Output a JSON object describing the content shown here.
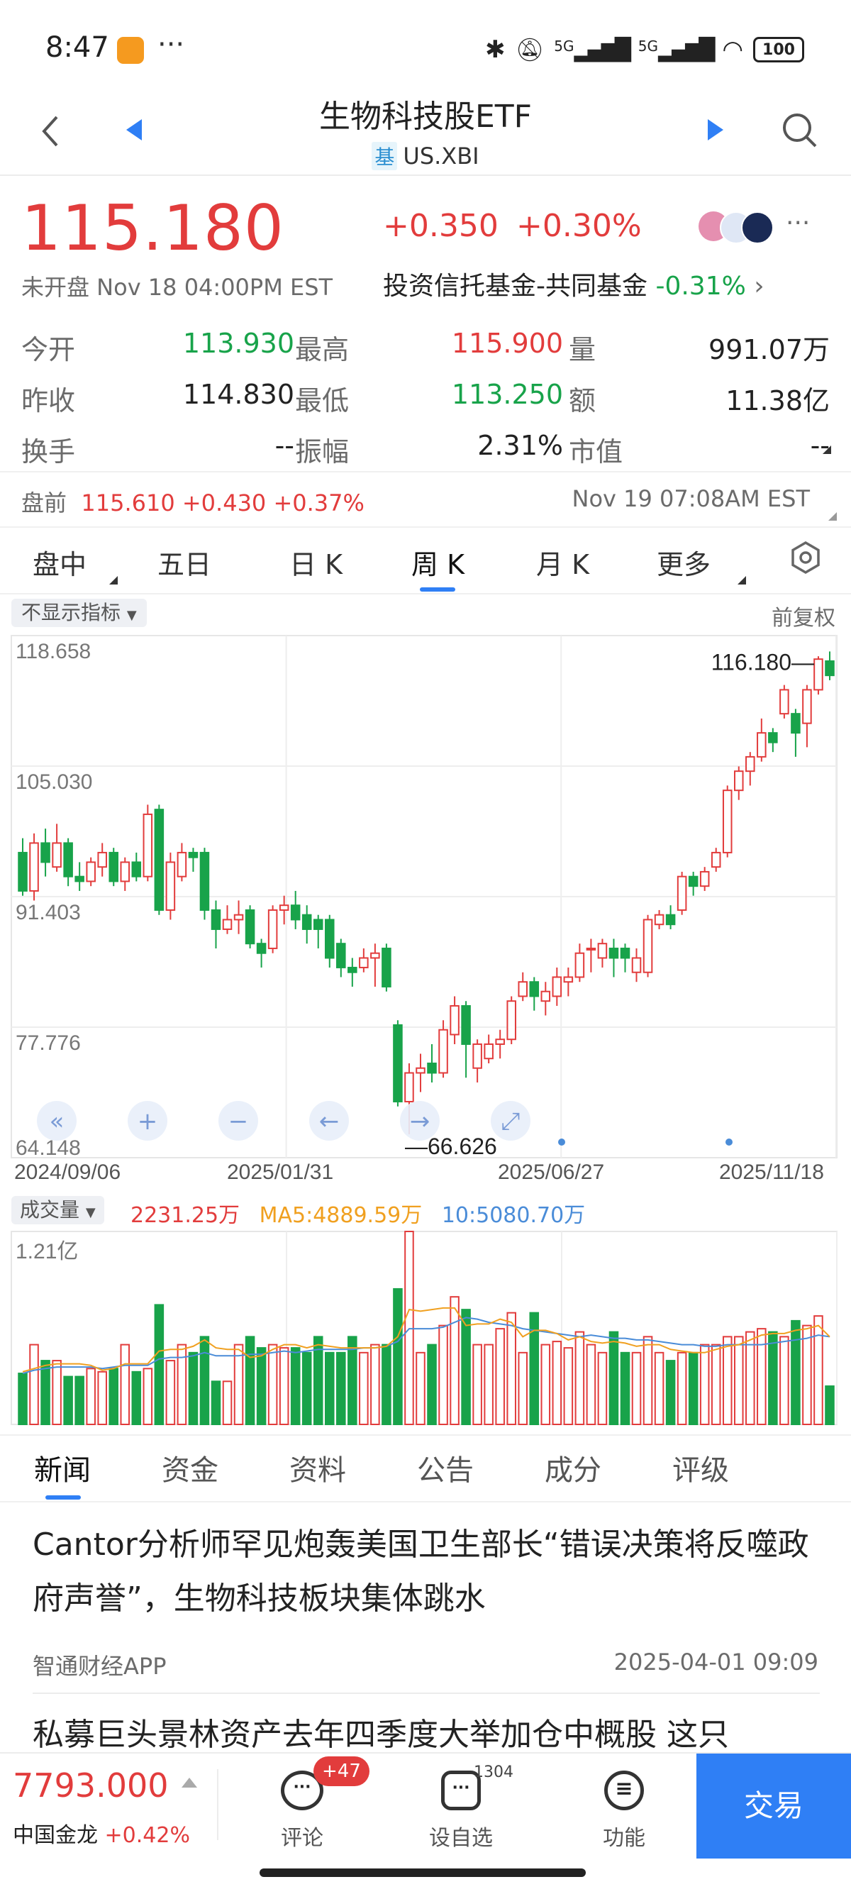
{
  "status": {
    "time": "8:47",
    "dots": "···",
    "signal1": "5G",
    "signal2": "5G",
    "battery": "100"
  },
  "header": {
    "title": "生物科技股ETF",
    "tag": "基",
    "code": "US.XBI"
  },
  "quote": {
    "price": "115.180",
    "change": "+0.350",
    "change_pct": "+0.30%",
    "status_text": "未开盘 Nov 18 04:00PM EST",
    "sector": "投资信托基金-共同基金",
    "sector_change": "-0.31%"
  },
  "stats": {
    "open_label": "今开",
    "open": "113.930",
    "high_label": "最高",
    "high": "115.900",
    "volume_label": "量",
    "volume": "991.07万",
    "prev_label": "昨收",
    "prev": "114.830",
    "low_label": "最低",
    "low": "113.250",
    "amount_label": "额",
    "amount": "11.38亿",
    "turnover_label": "换手",
    "turnover": "--",
    "amplitude_label": "振幅",
    "amplitude": "2.31%",
    "mcap_label": "市值",
    "mcap": "--"
  },
  "premarket": {
    "label": "盘前",
    "price": "115.610",
    "change": "+0.430",
    "pct": "+0.37%",
    "time": "Nov 19 07:08AM EST"
  },
  "chart_tabs": [
    "盘中",
    "五日",
    "日 K",
    "周 K",
    "月 K",
    "更多"
  ],
  "chart_header": {
    "indicator": "不显示指标",
    "adjust": "前复权"
  },
  "volume_header": {
    "label": "成交量",
    "vol": "2231.25万",
    "ma5": "MA5:4889.59万",
    "ma10": "10:5080.70万",
    "max": "1.21亿"
  },
  "colors": {
    "up": "#e23c3c",
    "down": "#18a34a",
    "accent": "#2f7ff5",
    "ma5": "#f0a020",
    "ma10": "#4a8cd8"
  },
  "chart_data": {
    "type": "candlestick",
    "y_ticks": [
      "118.658",
      "105.030",
      "91.403",
      "77.776",
      "64.148"
    ],
    "ylim": [
      64.148,
      118.658
    ],
    "x_labels": [
      "2024/09/06",
      "2025/01/31",
      "2025/06/27",
      "2025/11/18"
    ],
    "annotations": {
      "max_label": "116.180",
      "min_label": "66.626"
    },
    "candles": [
      [
        96.0,
        92.0,
        97.5,
        91.5
      ],
      [
        92.0,
        97.0,
        98.0,
        91.0
      ],
      [
        97.0,
        95.0,
        98.5,
        93.5
      ],
      [
        94.5,
        97.0,
        99.0,
        94.0
      ],
      [
        97.0,
        93.5,
        97.5,
        92.5
      ],
      [
        93.5,
        93.0,
        95.0,
        92.0
      ],
      [
        93.0,
        95.0,
        95.5,
        92.5
      ],
      [
        94.5,
        96.0,
        97.0,
        93.5
      ],
      [
        96.0,
        93.0,
        96.5,
        92.5
      ],
      [
        93.0,
        95.0,
        95.5,
        92.0
      ],
      [
        95.0,
        93.5,
        96.0,
        93.0
      ],
      [
        93.5,
        100.0,
        101.0,
        93.0
      ],
      [
        100.5,
        90.0,
        101.0,
        89.5
      ],
      [
        90.0,
        95.0,
        96.0,
        89.0
      ],
      [
        93.5,
        96.0,
        97.0,
        93.0
      ],
      [
        96.0,
        95.5,
        96.5,
        94.0
      ],
      [
        96.0,
        90.0,
        96.5,
        89.0
      ],
      [
        90.0,
        88.0,
        91.0,
        86.0
      ],
      [
        88.0,
        89.0,
        90.5,
        87.5
      ],
      [
        89.0,
        89.5,
        91.0,
        87.5
      ],
      [
        90.0,
        86.5,
        90.5,
        86.0
      ],
      [
        86.5,
        85.5,
        87.0,
        84.0
      ],
      [
        86.0,
        90.0,
        90.5,
        85.5
      ],
      [
        90.0,
        90.5,
        91.5,
        88.5
      ],
      [
        90.5,
        89.0,
        92.0,
        88.0
      ],
      [
        89.5,
        88.0,
        90.5,
        86.5
      ],
      [
        89.0,
        88.0,
        89.5,
        86.0
      ],
      [
        89.0,
        85.0,
        89.5,
        84.0
      ],
      [
        86.5,
        84.0,
        87.0,
        83.0
      ],
      [
        84.0,
        83.5,
        85.0,
        82.0
      ],
      [
        84.0,
        85.0,
        86.0,
        83.5
      ],
      [
        85.0,
        85.5,
        86.5,
        82.0
      ],
      [
        86.0,
        82.0,
        86.5,
        81.5
      ],
      [
        78.0,
        70.0,
        78.5,
        69.5
      ],
      [
        70.0,
        73.0,
        74.0,
        66.6
      ],
      [
        73.0,
        73.5,
        75.0,
        71.0
      ],
      [
        74.0,
        73.0,
        76.0,
        72.0
      ],
      [
        73.0,
        77.5,
        78.5,
        72.5
      ],
      [
        77.0,
        80.0,
        81.0,
        76.0
      ],
      [
        80.0,
        76.0,
        80.5,
        72.5
      ],
      [
        73.5,
        76.0,
        76.5,
        72.0
      ],
      [
        74.5,
        76.0,
        77.0,
        74.0
      ],
      [
        76.0,
        76.5,
        77.5,
        74.5
      ],
      [
        76.5,
        80.5,
        81.0,
        76.0
      ],
      [
        81.0,
        82.5,
        83.5,
        80.5
      ],
      [
        82.5,
        81.0,
        83.0,
        79.5
      ],
      [
        80.5,
        81.5,
        82.5,
        79.0
      ],
      [
        81.0,
        83.0,
        84.0,
        80.0
      ],
      [
        82.5,
        83.0,
        84.0,
        81.0
      ],
      [
        83.0,
        85.5,
        86.5,
        82.5
      ],
      [
        86.0,
        86.0,
        87.0,
        83.5
      ],
      [
        85.0,
        86.5,
        87.0,
        84.0
      ],
      [
        86.0,
        85.0,
        87.0,
        83.0
      ],
      [
        86.0,
        85.0,
        86.5,
        83.5
      ],
      [
        83.5,
        85.0,
        86.0,
        82.5
      ],
      [
        83.5,
        89.0,
        89.5,
        83.0
      ],
      [
        88.5,
        89.5,
        90.0,
        88.0
      ],
      [
        89.5,
        88.5,
        90.5,
        88.0
      ],
      [
        90.0,
        93.5,
        94.0,
        89.5
      ],
      [
        93.5,
        92.5,
        94.0,
        91.5
      ],
      [
        92.5,
        94.0,
        94.5,
        92.0
      ],
      [
        94.5,
        96.0,
        96.5,
        94.0
      ],
      [
        96.0,
        102.5,
        103.0,
        95.5
      ],
      [
        102.5,
        104.5,
        105.0,
        101.5
      ],
      [
        104.5,
        106.0,
        106.5,
        103.0
      ],
      [
        106.0,
        108.5,
        110.0,
        105.5
      ],
      [
        108.5,
        107.5,
        109.0,
        106.5
      ],
      [
        110.5,
        113.0,
        113.5,
        110.0
      ],
      [
        110.5,
        108.5,
        111.0,
        106.0
      ],
      [
        109.5,
        113.0,
        113.5,
        107.0
      ],
      [
        113.0,
        116.2,
        116.5,
        112.5
      ],
      [
        116.0,
        114.5,
        117.0,
        114.0
      ]
    ],
    "volume_ylim": [
      0,
      1.21
    ],
    "volumes": [
      0.32,
      0.5,
      0.4,
      0.4,
      0.3,
      0.3,
      0.35,
      0.33,
      0.35,
      0.5,
      0.33,
      0.35,
      0.75,
      0.4,
      0.5,
      0.45,
      0.55,
      0.27,
      0.27,
      0.5,
      0.55,
      0.48,
      0.5,
      0.48,
      0.48,
      0.45,
      0.55,
      0.45,
      0.45,
      0.55,
      0.45,
      0.5,
      0.5,
      0.85,
      1.21,
      0.45,
      0.5,
      0.62,
      0.8,
      0.72,
      0.5,
      0.5,
      0.6,
      0.7,
      0.45,
      0.7,
      0.5,
      0.52,
      0.48,
      0.58,
      0.5,
      0.45,
      0.58,
      0.45,
      0.45,
      0.55,
      0.45,
      0.4,
      0.45,
      0.45,
      0.5,
      0.5,
      0.55,
      0.55,
      0.58,
      0.6,
      0.58,
      0.55,
      0.65,
      0.62,
      0.68,
      0.24
    ],
    "ma5": [
      0.33,
      0.35,
      0.37,
      0.38,
      0.38,
      0.38,
      0.37,
      0.34,
      0.35,
      0.38,
      0.38,
      0.38,
      0.46,
      0.47,
      0.47,
      0.49,
      0.53,
      0.48,
      0.47,
      0.47,
      0.42,
      0.43,
      0.47,
      0.5,
      0.5,
      0.48,
      0.5,
      0.49,
      0.48,
      0.48,
      0.48,
      0.48,
      0.49,
      0.55,
      0.72,
      0.71,
      0.72,
      0.73,
      0.73,
      0.62,
      0.63,
      0.63,
      0.66,
      0.64,
      0.55,
      0.59,
      0.59,
      0.57,
      0.53,
      0.55,
      0.52,
      0.51,
      0.52,
      0.51,
      0.49,
      0.5,
      0.5,
      0.47,
      0.46,
      0.45,
      0.45,
      0.47,
      0.49,
      0.5,
      0.53,
      0.56,
      0.57,
      0.57,
      0.59,
      0.6,
      0.62,
      0.55
    ],
    "ma10": [
      0.32,
      0.34,
      0.35,
      0.36,
      0.36,
      0.36,
      0.36,
      0.35,
      0.36,
      0.37,
      0.37,
      0.37,
      0.41,
      0.42,
      0.42,
      0.43,
      0.45,
      0.43,
      0.43,
      0.43,
      0.44,
      0.44,
      0.45,
      0.46,
      0.45,
      0.46,
      0.47,
      0.47,
      0.47,
      0.47,
      0.48,
      0.48,
      0.49,
      0.52,
      0.6,
      0.6,
      0.6,
      0.61,
      0.64,
      0.67,
      0.66,
      0.64,
      0.63,
      0.62,
      0.6,
      0.59,
      0.58,
      0.57,
      0.56,
      0.55,
      0.56,
      0.55,
      0.54,
      0.54,
      0.53,
      0.53,
      0.52,
      0.51,
      0.5,
      0.5,
      0.49,
      0.49,
      0.5,
      0.5,
      0.5,
      0.5,
      0.51,
      0.52,
      0.53,
      0.54,
      0.56,
      0.55
    ]
  },
  "news_tabs": [
    "新闻",
    "资金",
    "资料",
    "公告",
    "成分",
    "评级"
  ],
  "news": [
    {
      "title": "Cantor分析师罕见炮轰美国卫生部长“错误决策将反噬政府声誉”，生物科技板块集体跳水",
      "source": "智通财经APP",
      "date": "2025-04-01 09:09"
    },
    {
      "title": "私募巨头景林资产去年四季度大举加仓中概股 这只"
    }
  ],
  "bottom": {
    "index_value": "7793.000",
    "index_name": "中国金龙",
    "index_pct": "+0.42%",
    "comment_label": "评论",
    "comment_badge": "+47",
    "watch_label": "设自选",
    "watch_count": "1304",
    "func_label": "功能",
    "trade_label": "交易"
  }
}
